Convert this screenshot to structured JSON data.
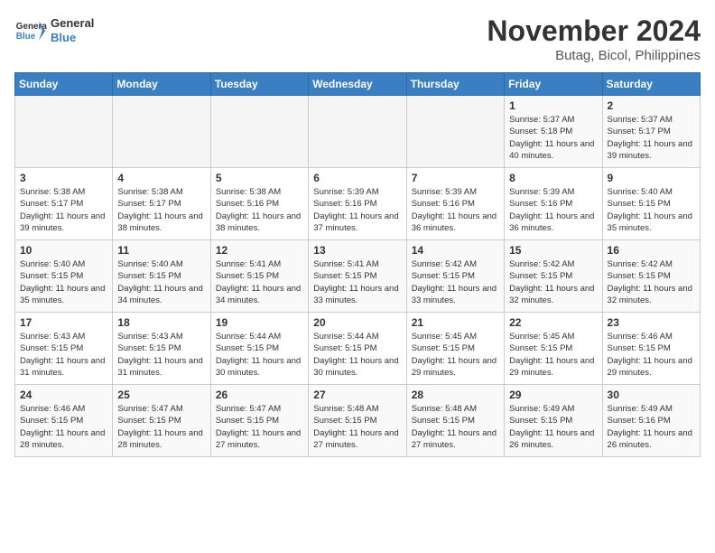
{
  "header": {
    "logo_line1": "General",
    "logo_line2": "Blue",
    "month": "November 2024",
    "location": "Butag, Bicol, Philippines"
  },
  "days_of_week": [
    "Sunday",
    "Monday",
    "Tuesday",
    "Wednesday",
    "Thursday",
    "Friday",
    "Saturday"
  ],
  "weeks": [
    [
      {
        "day": "",
        "sunrise": "",
        "sunset": "",
        "daylight": "",
        "empty": true
      },
      {
        "day": "",
        "sunrise": "",
        "sunset": "",
        "daylight": "",
        "empty": true
      },
      {
        "day": "",
        "sunrise": "",
        "sunset": "",
        "daylight": "",
        "empty": true
      },
      {
        "day": "",
        "sunrise": "",
        "sunset": "",
        "daylight": "",
        "empty": true
      },
      {
        "day": "",
        "sunrise": "",
        "sunset": "",
        "daylight": "",
        "empty": true
      },
      {
        "day": "1",
        "sunrise": "Sunrise: 5:37 AM",
        "sunset": "Sunset: 5:18 PM",
        "daylight": "Daylight: 11 hours and 40 minutes."
      },
      {
        "day": "2",
        "sunrise": "Sunrise: 5:37 AM",
        "sunset": "Sunset: 5:17 PM",
        "daylight": "Daylight: 11 hours and 39 minutes."
      }
    ],
    [
      {
        "day": "3",
        "sunrise": "Sunrise: 5:38 AM",
        "sunset": "Sunset: 5:17 PM",
        "daylight": "Daylight: 11 hours and 39 minutes."
      },
      {
        "day": "4",
        "sunrise": "Sunrise: 5:38 AM",
        "sunset": "Sunset: 5:17 PM",
        "daylight": "Daylight: 11 hours and 38 minutes."
      },
      {
        "day": "5",
        "sunrise": "Sunrise: 5:38 AM",
        "sunset": "Sunset: 5:16 PM",
        "daylight": "Daylight: 11 hours and 38 minutes."
      },
      {
        "day": "6",
        "sunrise": "Sunrise: 5:39 AM",
        "sunset": "Sunset: 5:16 PM",
        "daylight": "Daylight: 11 hours and 37 minutes."
      },
      {
        "day": "7",
        "sunrise": "Sunrise: 5:39 AM",
        "sunset": "Sunset: 5:16 PM",
        "daylight": "Daylight: 11 hours and 36 minutes."
      },
      {
        "day": "8",
        "sunrise": "Sunrise: 5:39 AM",
        "sunset": "Sunset: 5:16 PM",
        "daylight": "Daylight: 11 hours and 36 minutes."
      },
      {
        "day": "9",
        "sunrise": "Sunrise: 5:40 AM",
        "sunset": "Sunset: 5:15 PM",
        "daylight": "Daylight: 11 hours and 35 minutes."
      }
    ],
    [
      {
        "day": "10",
        "sunrise": "Sunrise: 5:40 AM",
        "sunset": "Sunset: 5:15 PM",
        "daylight": "Daylight: 11 hours and 35 minutes."
      },
      {
        "day": "11",
        "sunrise": "Sunrise: 5:40 AM",
        "sunset": "Sunset: 5:15 PM",
        "daylight": "Daylight: 11 hours and 34 minutes."
      },
      {
        "day": "12",
        "sunrise": "Sunrise: 5:41 AM",
        "sunset": "Sunset: 5:15 PM",
        "daylight": "Daylight: 11 hours and 34 minutes."
      },
      {
        "day": "13",
        "sunrise": "Sunrise: 5:41 AM",
        "sunset": "Sunset: 5:15 PM",
        "daylight": "Daylight: 11 hours and 33 minutes."
      },
      {
        "day": "14",
        "sunrise": "Sunrise: 5:42 AM",
        "sunset": "Sunset: 5:15 PM",
        "daylight": "Daylight: 11 hours and 33 minutes."
      },
      {
        "day": "15",
        "sunrise": "Sunrise: 5:42 AM",
        "sunset": "Sunset: 5:15 PM",
        "daylight": "Daylight: 11 hours and 32 minutes."
      },
      {
        "day": "16",
        "sunrise": "Sunrise: 5:42 AM",
        "sunset": "Sunset: 5:15 PM",
        "daylight": "Daylight: 11 hours and 32 minutes."
      }
    ],
    [
      {
        "day": "17",
        "sunrise": "Sunrise: 5:43 AM",
        "sunset": "Sunset: 5:15 PM",
        "daylight": "Daylight: 11 hours and 31 minutes."
      },
      {
        "day": "18",
        "sunrise": "Sunrise: 5:43 AM",
        "sunset": "Sunset: 5:15 PM",
        "daylight": "Daylight: 11 hours and 31 minutes."
      },
      {
        "day": "19",
        "sunrise": "Sunrise: 5:44 AM",
        "sunset": "Sunset: 5:15 PM",
        "daylight": "Daylight: 11 hours and 30 minutes."
      },
      {
        "day": "20",
        "sunrise": "Sunrise: 5:44 AM",
        "sunset": "Sunset: 5:15 PM",
        "daylight": "Daylight: 11 hours and 30 minutes."
      },
      {
        "day": "21",
        "sunrise": "Sunrise: 5:45 AM",
        "sunset": "Sunset: 5:15 PM",
        "daylight": "Daylight: 11 hours and 29 minutes."
      },
      {
        "day": "22",
        "sunrise": "Sunrise: 5:45 AM",
        "sunset": "Sunset: 5:15 PM",
        "daylight": "Daylight: 11 hours and 29 minutes."
      },
      {
        "day": "23",
        "sunrise": "Sunrise: 5:46 AM",
        "sunset": "Sunset: 5:15 PM",
        "daylight": "Daylight: 11 hours and 29 minutes."
      }
    ],
    [
      {
        "day": "24",
        "sunrise": "Sunrise: 5:46 AM",
        "sunset": "Sunset: 5:15 PM",
        "daylight": "Daylight: 11 hours and 28 minutes."
      },
      {
        "day": "25",
        "sunrise": "Sunrise: 5:47 AM",
        "sunset": "Sunset: 5:15 PM",
        "daylight": "Daylight: 11 hours and 28 minutes."
      },
      {
        "day": "26",
        "sunrise": "Sunrise: 5:47 AM",
        "sunset": "Sunset: 5:15 PM",
        "daylight": "Daylight: 11 hours and 27 minutes."
      },
      {
        "day": "27",
        "sunrise": "Sunrise: 5:48 AM",
        "sunset": "Sunset: 5:15 PM",
        "daylight": "Daylight: 11 hours and 27 minutes."
      },
      {
        "day": "28",
        "sunrise": "Sunrise: 5:48 AM",
        "sunset": "Sunset: 5:15 PM",
        "daylight": "Daylight: 11 hours and 27 minutes."
      },
      {
        "day": "29",
        "sunrise": "Sunrise: 5:49 AM",
        "sunset": "Sunset: 5:15 PM",
        "daylight": "Daylight: 11 hours and 26 minutes."
      },
      {
        "day": "30",
        "sunrise": "Sunrise: 5:49 AM",
        "sunset": "Sunset: 5:16 PM",
        "daylight": "Daylight: 11 hours and 26 minutes."
      }
    ]
  ]
}
